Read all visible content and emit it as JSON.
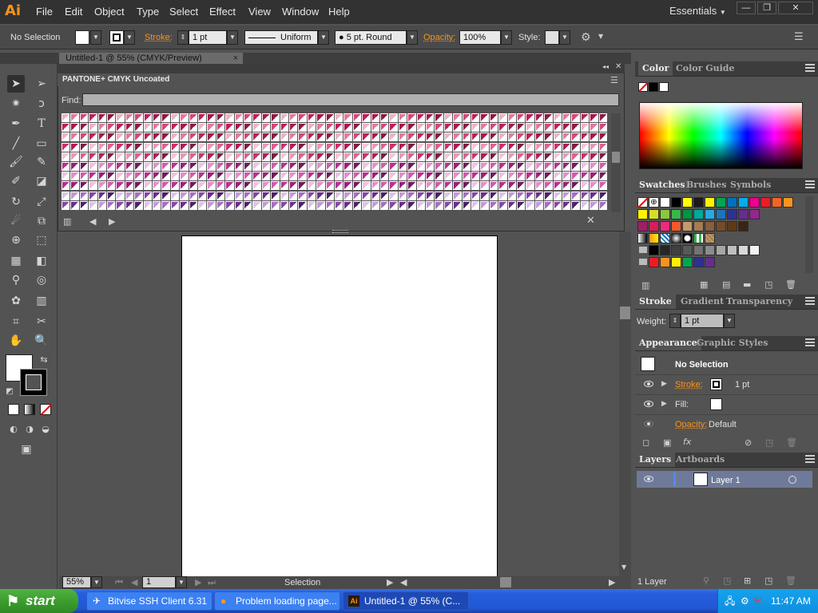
{
  "menubar": {
    "logo": "Ai",
    "items": [
      "File",
      "Edit",
      "Object",
      "Type",
      "Select",
      "Effect",
      "View",
      "Window",
      "Help"
    ],
    "workspace": "Essentials"
  },
  "controlbar": {
    "selection": "No Selection",
    "stroke_label": "Stroke:",
    "stroke_value": "1 pt",
    "profile": "Uniform",
    "brush": "5 pt. Round",
    "opacity_label": "Opacity:",
    "opacity_value": "100%",
    "style_label": "Style:"
  },
  "document": {
    "tab_title": "Untitled-1 @ 55% (CMYK/Preview)",
    "zoom": "55%",
    "artboard_number": "1",
    "status_tool": "Selection"
  },
  "pantone_panel": {
    "title": "PANTONE+ CMYK Uncoated",
    "find_label": "Find:",
    "colors": [
      "#e8b4c4",
      "#e07a9c",
      "#d4477a",
      "#c21d5c",
      "#a8174e",
      "#8e1a44",
      "#f1c6d6",
      "#e997b5",
      "#de5f8f",
      "#cf2f6e",
      "#b61a58",
      "#7e1d45",
      "#eec1e0",
      "#e28fc9",
      "#d15aae",
      "#bb2e92",
      "#9a1f7a",
      "#6e1c5c",
      "#dcc4e4",
      "#c39ad4",
      "#a56fbe",
      "#8647a6",
      "#6b2d8c",
      "#4d2166"
    ]
  },
  "color_panel": {
    "tabs": [
      "Color",
      "Color Guide"
    ]
  },
  "swatches_panel": {
    "tabs": [
      "Swatches",
      "Brushes",
      "Symbols"
    ],
    "row1": [
      "#000000",
      "#ffff00",
      "#1a1a1a",
      "#fff200",
      "#00a651",
      "#0072bc",
      "#00aeef",
      "#ec008c",
      "#ed1c24",
      "#f26522",
      "#f7941d"
    ],
    "row2": [
      "#fff200",
      "#d7df23",
      "#8dc63f",
      "#39b54a",
      "#009444",
      "#00a99d",
      "#27aae1",
      "#1c75bc",
      "#2e3192",
      "#662d91",
      "#92278f"
    ],
    "row3": [
      "#9e1f63",
      "#da1c5c",
      "#ee2a7b",
      "#f15a29",
      "#c49a6c",
      "#a67c52",
      "#8b5e3c",
      "#754c29",
      "#603913",
      "#3c2415"
    ],
    "row5": [
      "#000000",
      "#262626",
      "#404040",
      "#595959",
      "#737373",
      "#8c8c8c",
      "#a6a6a6",
      "#bfbfbf",
      "#d9d9d9",
      "#f2f2f2"
    ],
    "row6": [
      "#ed1c24",
      "#f7941d",
      "#fff200",
      "#00a651",
      "#2e3192",
      "#662d91"
    ]
  },
  "stroke_panel": {
    "tabs": [
      "Stroke",
      "Gradient",
      "Transparency"
    ],
    "weight_label": "Weight:",
    "weight_value": "1 pt"
  },
  "appearance_panel": {
    "tabs": [
      "Appearance",
      "Graphic Styles"
    ],
    "header": "No Selection",
    "stroke_label": "Stroke:",
    "stroke_value": "1 pt",
    "fill_label": "Fill:",
    "opacity_label": "Opacity:",
    "opacity_value": "Default"
  },
  "layers_panel": {
    "tabs": [
      "Layers",
      "Artboards"
    ],
    "layer_name": "Layer 1",
    "count": "1 Layer"
  },
  "taskbar": {
    "start": "start",
    "items": [
      "Bitvise SSH Client 6.31",
      "Problem loading page...",
      "Untitled-1 @ 55% (C..."
    ],
    "clock": "11:47 AM"
  }
}
